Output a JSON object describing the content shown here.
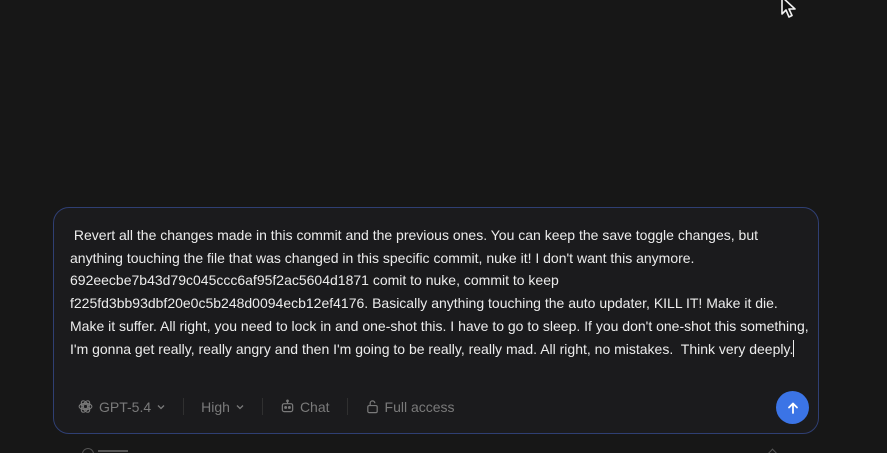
{
  "composer": {
    "prompt_text": " Revert all the changes made in this commit and the previous ones. You can keep the save toggle changes, but anything touching the file that was changed in this specific commit, nuke it! I don't want this anymore. 692eecbe7b43d79c045ccc6af95f2ac5604d1871 comit to nuke, commit to keep f225fd3bb93dbf20e0c5b248d0094ecb12ef4176. Basically anything touching the auto updater, KILL IT! Make it die. Make it suffer. All right, you need to lock in and one-shot this. I have to go to sleep. If you don't one-shot this something, I'm gonna get really, really angry and then I'm going to be really, really mad. All right, no mistakes.  Think very deeply."
  },
  "toolbar": {
    "model_label": "GPT-5.4",
    "model_icon": "openai-icon",
    "effort_label": "High",
    "mode_label": "Chat",
    "mode_icon": "robot-icon",
    "access_label": "Full access",
    "access_icon": "unlock-icon"
  },
  "send": {
    "icon": "arrow-up-icon",
    "color": "#3b74e6"
  },
  "colors": {
    "background": "#171717",
    "composer_border": "#2f3f73",
    "text": "#ececec",
    "muted": "#7a7a7a"
  }
}
